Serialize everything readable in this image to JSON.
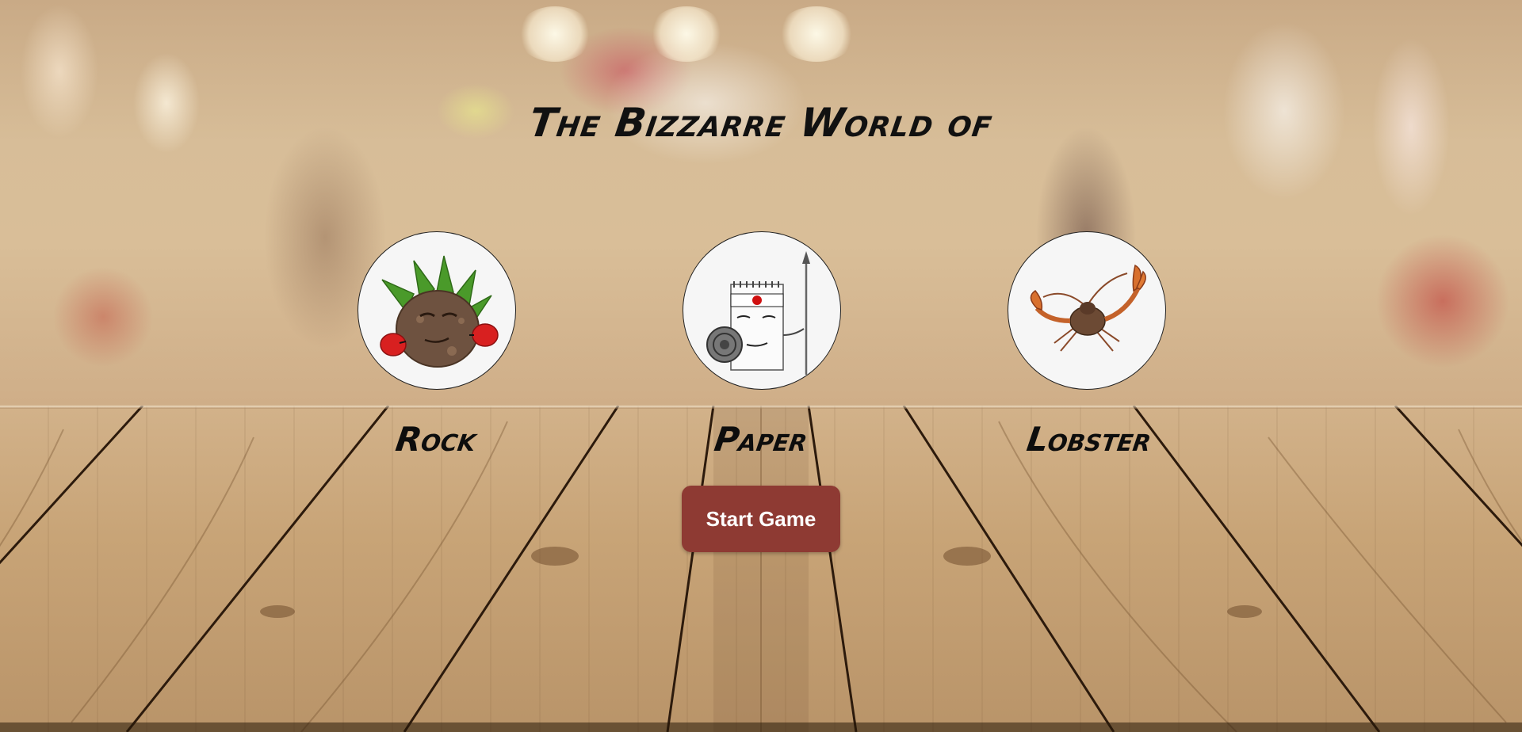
{
  "title": "The Bizzarre World of",
  "choices": [
    {
      "label": "Rock",
      "icon": "rock-character-icon"
    },
    {
      "label": "Paper",
      "icon": "paper-character-icon"
    },
    {
      "label": "Lobster",
      "icon": "lobster-icon"
    }
  ],
  "start_button_label": "Start Game",
  "colors": {
    "button": "#8e3a33",
    "text": "#111111",
    "circle": "#f6f6f6"
  }
}
